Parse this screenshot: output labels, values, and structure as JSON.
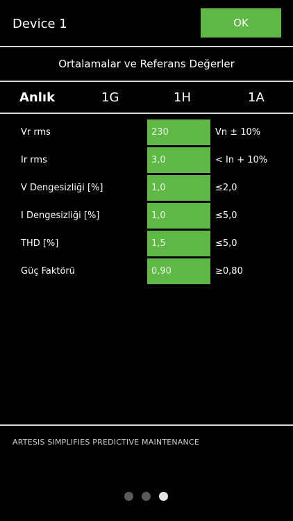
{
  "header": {
    "title": "Device 1",
    "ok_label": "OK"
  },
  "subtitle": "Ortalamalar ve Referans Değerler",
  "tabs": [
    {
      "label": "Anlık",
      "active": true
    },
    {
      "label": "1G",
      "active": false
    },
    {
      "label": "1H",
      "active": false
    },
    {
      "label": "1A",
      "active": false
    }
  ],
  "rows": [
    {
      "label": "Vr rms",
      "value": "230",
      "reference": "Vn ± 10%"
    },
    {
      "label": "Ir rms",
      "value": "3,0",
      "reference": "< In + 10%"
    },
    {
      "label": "V Dengesizliği [%]",
      "value": "1,0",
      "reference": "≤2,0"
    },
    {
      "label": "I Dengesizliği [%]",
      "value": "1,0",
      "reference": "≤5,0"
    },
    {
      "label": "THD [%]",
      "value": "1,5",
      "reference": "≤5,0"
    },
    {
      "label": "Güç Faktörü",
      "value": "0,90",
      "reference": "≥0,80"
    }
  ],
  "footer": {
    "tagline": "ARTESIS SIMPLIFIES PREDICTIVE MAINTENANCE"
  },
  "pagination": {
    "total": 3,
    "current": 3
  },
  "colors": {
    "accent": "#5fb845",
    "background": "#000000",
    "divider": "#d9d9d9"
  }
}
